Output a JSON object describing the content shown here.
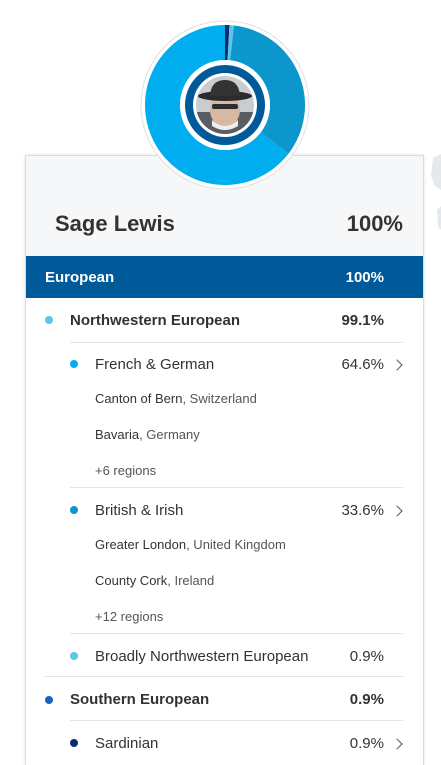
{
  "profile": {
    "name": "Sage Lewis",
    "total_pct": "100%"
  },
  "chart_data": {
    "type": "pie",
    "categories": [
      "French & German",
      "British & Irish",
      "Broadly Northwestern European",
      "Sardinian"
    ],
    "values": [
      64.6,
      33.6,
      0.9,
      0.9
    ],
    "colors": [
      "#00aeef",
      "#0b96cc",
      "#5cc6ea",
      "#0a2d6b"
    ]
  },
  "region": {
    "label": "European",
    "pct": "100%"
  },
  "groups": [
    {
      "label": "Northwestern European",
      "pct": "99.1%",
      "dot_color": "#5cc6ea",
      "items": [
        {
          "label": "French & German",
          "pct": "64.6%",
          "dot_color": "#00aeef",
          "places": [
            {
              "city": "Canton of Bern",
              "region": ", Switzerland"
            },
            {
              "city": "Bavaria",
              "region": ", Germany"
            }
          ],
          "more": "+6 regions"
        },
        {
          "label": "British & Irish",
          "pct": "33.6%",
          "dot_color": "#0b96cc",
          "places": [
            {
              "city": "Greater London",
              "region": ", United Kingdom"
            },
            {
              "city": "County Cork",
              "region": ", Ireland"
            }
          ],
          "more": "+12 regions"
        },
        {
          "label": "Broadly Northwestern European",
          "pct": "0.9%",
          "dot_color": "#5cc6ea"
        }
      ]
    },
    {
      "label": "Southern European",
      "pct": "0.9%",
      "dot_color": "#1565c0",
      "items": [
        {
          "label": "Sardinian",
          "pct": "0.9%",
          "dot_color": "#0a2d6b"
        }
      ]
    }
  ]
}
